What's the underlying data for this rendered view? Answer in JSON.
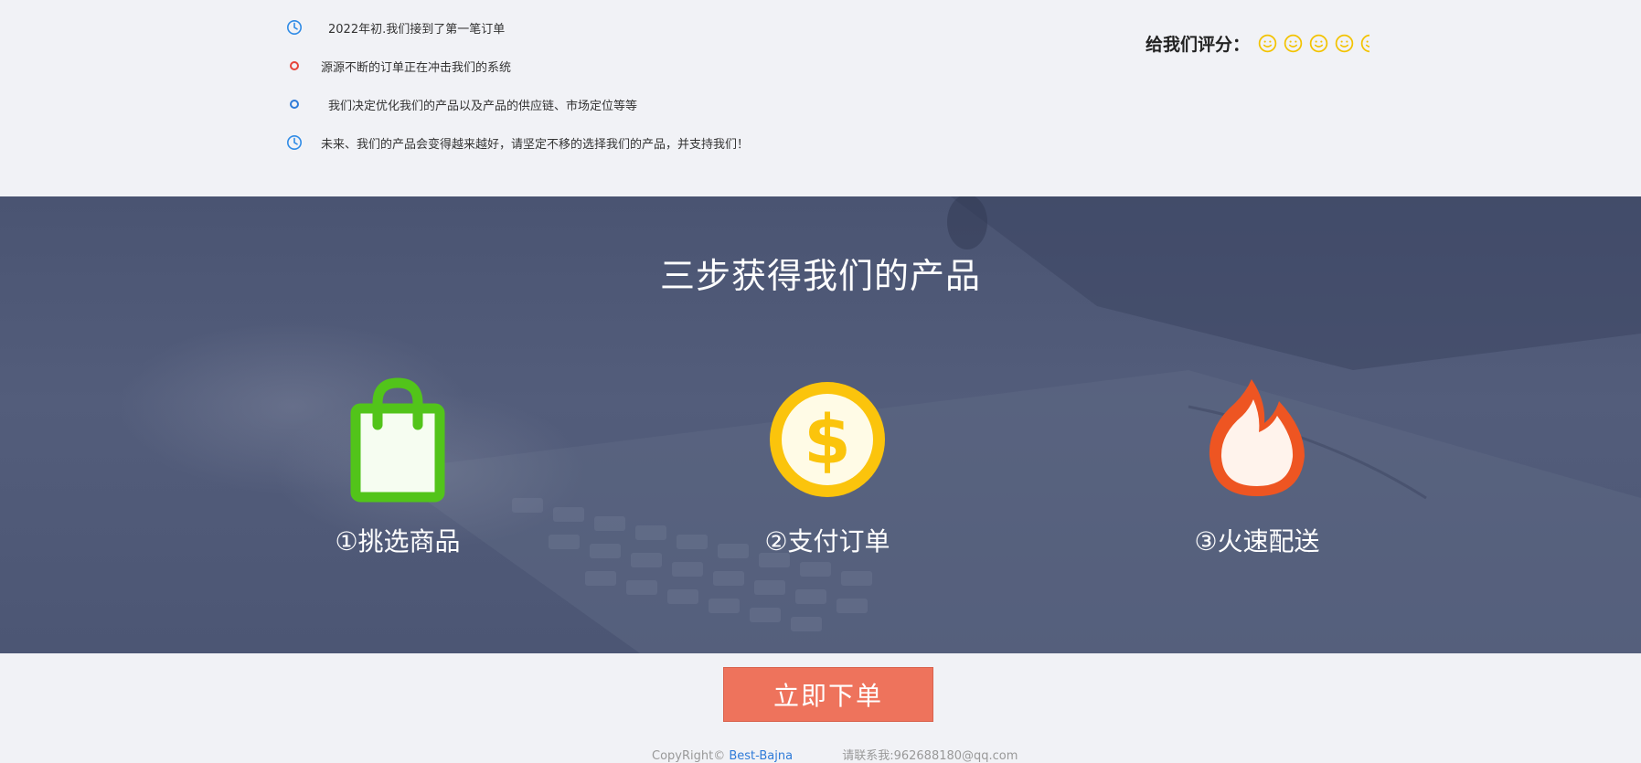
{
  "timeline": {
    "items": [
      {
        "text": "2022年初.我们接到了第一笔订单",
        "icon": "clock-icon",
        "color": "#2f8be6"
      },
      {
        "text": "源源不断的订单正在冲击我们的系统",
        "icon": "circle-icon",
        "color": "#e6453a"
      },
      {
        "text": "我们决定优化我们的产品以及产品的供应链、市场定位等等",
        "icon": "circle-icon",
        "color": "#2f7bd8"
      },
      {
        "text": "未来、我们的产品会变得越来越好，请坚定不移的选择我们的产品，并支持我们！",
        "icon": "clock-icon",
        "color": "#2f8be6"
      }
    ]
  },
  "rating": {
    "label": "给我们评分：",
    "icon": "smiley-icon",
    "color": "#f3c300"
  },
  "steps": {
    "title": "三步获得我们的产品",
    "items": [
      {
        "label": "①挑选商品",
        "icon": "shopping-bag-icon",
        "color": "#52c41a"
      },
      {
        "label": "②支付订单",
        "icon": "dollar-coin-icon",
        "color": "#fbc40c"
      },
      {
        "label": "③火速配送",
        "icon": "flame-icon",
        "color": "#ee5522"
      }
    ]
  },
  "order_button": {
    "label": "立即下单",
    "color": "#ee735c"
  },
  "footer": {
    "copyright_prefix": "CopyRight© ",
    "brand_link": "Best-Bajna",
    "contact": "请联系我:962688180@qq.com"
  }
}
